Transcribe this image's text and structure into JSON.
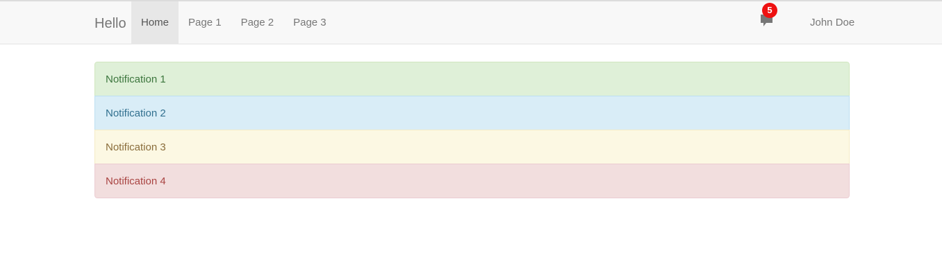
{
  "navbar": {
    "brand": "Hello",
    "items": [
      {
        "label": "Home",
        "active": true
      },
      {
        "label": "Page 1"
      },
      {
        "label": "Page 2"
      },
      {
        "label": "Page 3"
      }
    ],
    "messages_icon": "comment-icon",
    "badge_count": "5",
    "user_name": "John Doe"
  },
  "notifications": [
    {
      "label": "Notification 1",
      "bg": "#dff0d8",
      "color": "#3c763d",
      "border": "#d0e6be"
    },
    {
      "label": "Notification 2",
      "bg": "#d9edf7",
      "color": "#31708f",
      "border": "#bcdff1"
    },
    {
      "label": "Notification 3",
      "bg": "#fcf8e3",
      "color": "#8a6d3b",
      "border": "#f5ebc5"
    },
    {
      "label": "Notification 4",
      "bg": "#f2dede",
      "color": "#a94442",
      "border": "#ebccd1"
    }
  ]
}
